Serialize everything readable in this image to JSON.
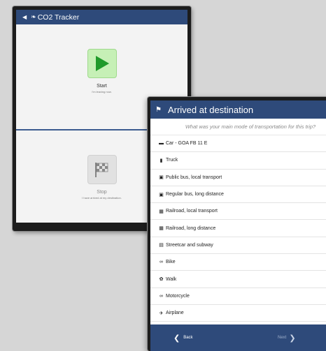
{
  "tracker": {
    "title": "CO2 Tracker",
    "start_label": "Start",
    "start_sub": "I'm leaving now.",
    "stop_label": "Stop",
    "stop_sub": "I have arrived at my destination."
  },
  "dialog": {
    "title": "Arrived at destination",
    "question": "What was your main mode of transportation for this trip?",
    "options": [
      {
        "icon": "car-icon",
        "label": "Car - GOA FB 11 E"
      },
      {
        "icon": "truck-icon",
        "label": "Truck"
      },
      {
        "icon": "bus-icon",
        "label": "Public bus, local transport"
      },
      {
        "icon": "bus-icon",
        "label": "Regular bus, long distance"
      },
      {
        "icon": "train-icon",
        "label": "Railroad, local transport"
      },
      {
        "icon": "train-icon",
        "label": "Railroad, long distance"
      },
      {
        "icon": "tram-icon",
        "label": "Streetcar and subway"
      },
      {
        "icon": "bike-icon",
        "label": "Bike"
      },
      {
        "icon": "walk-icon",
        "label": "Walk"
      },
      {
        "icon": "motorcycle-icon",
        "label": "Motorcycle"
      },
      {
        "icon": "airplane-icon",
        "label": "Airplane"
      }
    ],
    "back_label": "Back",
    "next_label": "Next"
  },
  "colors": {
    "header": "#2e4a7a",
    "start_green": "#c6f0b6",
    "play_green": "#1f9a2a"
  }
}
